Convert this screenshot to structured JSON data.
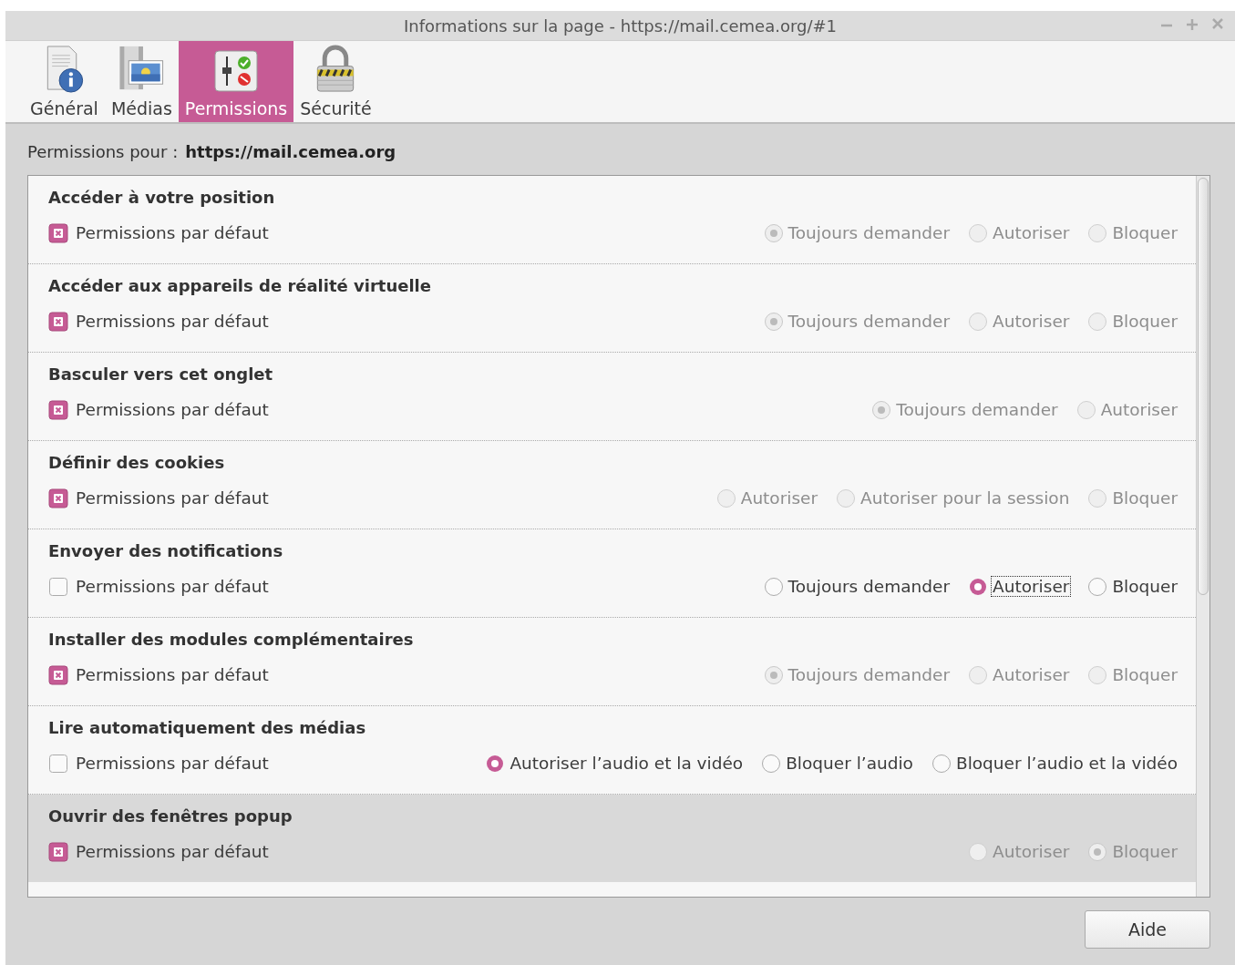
{
  "window": {
    "title": "Informations sur la page - https://mail.cemea.org/#1"
  },
  "tabs": [
    {
      "label": "Général",
      "selected": false
    },
    {
      "label": "Médias",
      "selected": false
    },
    {
      "label": "Permissions",
      "selected": true
    },
    {
      "label": "Sécurité",
      "selected": false
    }
  ],
  "permissions_for": {
    "label": "Permissions pour :",
    "site": "https://mail.cemea.org"
  },
  "permissions": [
    {
      "title": "Accéder à votre position",
      "default_label": "Permissions par défaut",
      "use_default": true,
      "highlighted": false,
      "options": [
        {
          "label": "Toujours demander",
          "selected": true,
          "focused": false
        },
        {
          "label": "Autoriser",
          "selected": false,
          "focused": false
        },
        {
          "label": "Bloquer",
          "selected": false,
          "focused": false
        }
      ]
    },
    {
      "title": "Accéder aux appareils de réalité virtuelle",
      "default_label": "Permissions par défaut",
      "use_default": true,
      "highlighted": false,
      "options": [
        {
          "label": "Toujours demander",
          "selected": true,
          "focused": false
        },
        {
          "label": "Autoriser",
          "selected": false,
          "focused": false
        },
        {
          "label": "Bloquer",
          "selected": false,
          "focused": false
        }
      ]
    },
    {
      "title": "Basculer vers cet onglet",
      "default_label": "Permissions par défaut",
      "use_default": true,
      "highlighted": false,
      "options": [
        {
          "label": "Toujours demander",
          "selected": true,
          "focused": false
        },
        {
          "label": "Autoriser",
          "selected": false,
          "focused": false
        }
      ]
    },
    {
      "title": "Définir des cookies",
      "default_label": "Permissions par défaut",
      "use_default": true,
      "highlighted": false,
      "options": [
        {
          "label": "Autoriser",
          "selected": false,
          "focused": false
        },
        {
          "label": "Autoriser pour la session",
          "selected": false,
          "focused": false
        },
        {
          "label": "Bloquer",
          "selected": false,
          "focused": false
        }
      ]
    },
    {
      "title": "Envoyer des notifications",
      "default_label": "Permissions par défaut",
      "use_default": false,
      "highlighted": false,
      "options": [
        {
          "label": "Toujours demander",
          "selected": false,
          "focused": false
        },
        {
          "label": "Autoriser",
          "selected": true,
          "focused": true
        },
        {
          "label": "Bloquer",
          "selected": false,
          "focused": false
        }
      ]
    },
    {
      "title": "Installer des modules complémentaires",
      "default_label": "Permissions par défaut",
      "use_default": true,
      "highlighted": false,
      "options": [
        {
          "label": "Toujours demander",
          "selected": true,
          "focused": false
        },
        {
          "label": "Autoriser",
          "selected": false,
          "focused": false
        },
        {
          "label": "Bloquer",
          "selected": false,
          "focused": false
        }
      ]
    },
    {
      "title": "Lire automatiquement des médias",
      "default_label": "Permissions par défaut",
      "use_default": false,
      "highlighted": false,
      "options": [
        {
          "label": "Autoriser l’audio et la vidéo",
          "selected": true,
          "focused": false
        },
        {
          "label": "Bloquer l’audio",
          "selected": false,
          "focused": false
        },
        {
          "label": "Bloquer l’audio et la vidéo",
          "selected": false,
          "focused": false
        }
      ]
    },
    {
      "title": "Ouvrir des fenêtres popup",
      "default_label": "Permissions par défaut",
      "use_default": true,
      "highlighted": true,
      "options": [
        {
          "label": "Autoriser",
          "selected": false,
          "focused": false
        },
        {
          "label": "Bloquer",
          "selected": true,
          "focused": false
        }
      ]
    }
  ],
  "buttons": [
    {
      "label": "Aide"
    }
  ]
}
